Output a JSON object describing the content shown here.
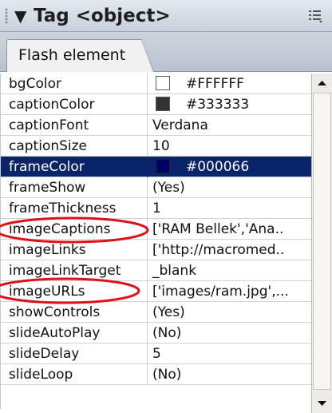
{
  "panel": {
    "title": "Tag <object>",
    "collapse_glyph": "▼",
    "options_icon": "options-menu-icon"
  },
  "tabs": [
    {
      "label": "Flash element"
    }
  ],
  "properties": [
    {
      "name": "bgColor",
      "value": "#FFFFFF",
      "swatch": "#FFFFFF"
    },
    {
      "name": "captionColor",
      "value": "#333333",
      "swatch": "#333333"
    },
    {
      "name": "captionFont",
      "value": "Verdana"
    },
    {
      "name": "captionSize",
      "value": "10"
    },
    {
      "name": "frameColor",
      "value": "#000066",
      "swatch": "#000066",
      "selected": true
    },
    {
      "name": "frameShow",
      "value": "(Yes)"
    },
    {
      "name": "frameThickness",
      "value": "1"
    },
    {
      "name": "imageCaptions",
      "value": "['RAM Bellek','Ana.."
    },
    {
      "name": "imageLinks",
      "value": "['http://macromed.."
    },
    {
      "name": "imageLinkTarget",
      "value": "_blank"
    },
    {
      "name": "imageURLs",
      "value": "['images/ram.jpg',..."
    },
    {
      "name": "showControls",
      "value": "(Yes)"
    },
    {
      "name": "slideAutoPlay",
      "value": "(No)"
    },
    {
      "name": "slideDelay",
      "value": "5"
    },
    {
      "name": "slideLoop",
      "value": "(No)"
    }
  ],
  "colors": {
    "selection": "#0a246a",
    "annotation": "#e0101a"
  }
}
